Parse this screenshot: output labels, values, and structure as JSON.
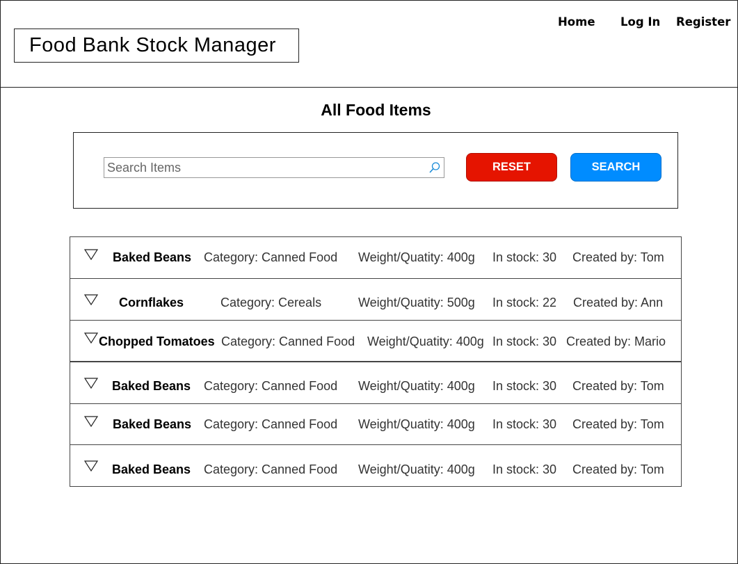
{
  "app": {
    "title": "Food Bank Stock Manager"
  },
  "nav": {
    "home": "Home",
    "login": "Log In",
    "register": "Register"
  },
  "page": {
    "title": "All Food Items"
  },
  "search": {
    "placeholder": "Search Items",
    "value": "",
    "icon": "search-icon",
    "reset_label": "RESET",
    "search_label": "SEARCH"
  },
  "colors": {
    "reset": "#e51400",
    "search": "#008cff"
  },
  "items": [
    {
      "name": "Baked Beans",
      "category": "Category: Canned Food",
      "weight": "Weight/Quatity: 400g",
      "stock": "In stock: 30",
      "created": "Created by: Tom"
    },
    {
      "name": "Cornflakes",
      "category": "Category: Cereals",
      "weight": "Weight/Quatity: 500g",
      "stock": "In stock: 22",
      "created": "Created by: Ann"
    },
    {
      "name": "Chopped Tomatoes",
      "category": "Category: Canned Food",
      "weight": "Weight/Quatity: 400g",
      "stock": "In stock: 30",
      "created": "Created by: Mario"
    },
    {
      "name": "Baked Beans",
      "category": "Category: Canned Food",
      "weight": "Weight/Quatity: 400g",
      "stock": "In stock: 30",
      "created": "Created by: Tom"
    },
    {
      "name": "Baked Beans",
      "category": "Category: Canned Food",
      "weight": "Weight/Quatity: 400g",
      "stock": "In stock: 30",
      "created": "Created by: Tom"
    },
    {
      "name": "Baked Beans",
      "category": "Category: Canned Food",
      "weight": "Weight/Quatity: 400g",
      "stock": "In stock: 30",
      "created": "Created by: Tom"
    }
  ]
}
